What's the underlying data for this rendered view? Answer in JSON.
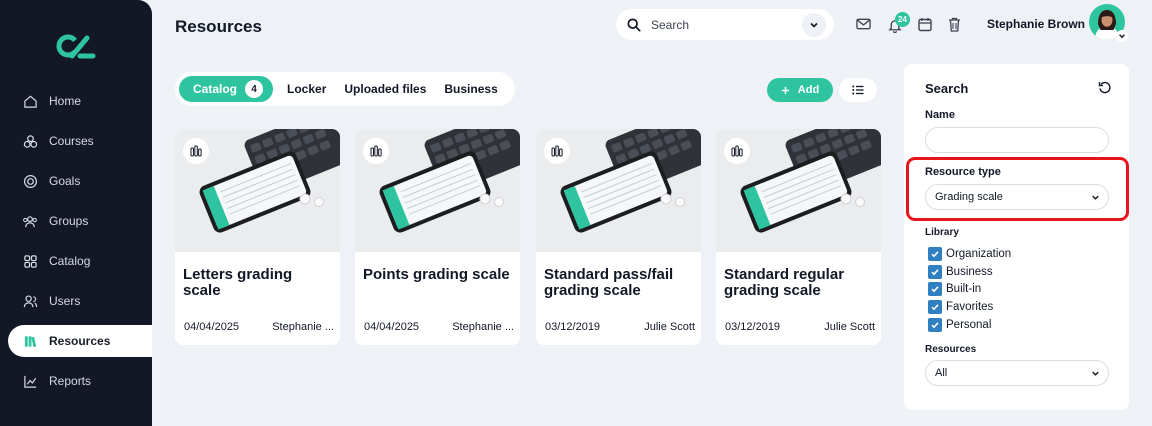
{
  "sidebar": {
    "items": [
      {
        "label": "Home",
        "icon": "home-icon",
        "active": false
      },
      {
        "label": "Courses",
        "icon": "courses-icon",
        "active": false
      },
      {
        "label": "Goals",
        "icon": "goals-icon",
        "active": false
      },
      {
        "label": "Groups",
        "icon": "groups-icon",
        "active": false
      },
      {
        "label": "Catalog",
        "icon": "catalog-icon",
        "active": false
      },
      {
        "label": "Users",
        "icon": "users-icon",
        "active": false
      },
      {
        "label": "Resources",
        "icon": "resources-icon",
        "active": true
      },
      {
        "label": "Reports",
        "icon": "reports-icon",
        "active": false
      }
    ]
  },
  "header": {
    "title": "Resources",
    "search_placeholder": "Search",
    "notification_count": "24",
    "user_name": "Stephanie Brown"
  },
  "tabs": [
    {
      "label": "Catalog",
      "count": "4",
      "active": true
    },
    {
      "label": "Locker"
    },
    {
      "label": "Uploaded files"
    },
    {
      "label": "Business"
    }
  ],
  "toolbar": {
    "add_label": "Add"
  },
  "cards": [
    {
      "title": "Letters grading scale",
      "date": "04/04/2025",
      "author": "Stephanie ..."
    },
    {
      "title": "Points grading scale",
      "date": "04/04/2025",
      "author": "Stephanie ..."
    },
    {
      "title": "Standard pass/fail grading scale",
      "date": "03/12/2019",
      "author": "Julie Scott"
    },
    {
      "title": "Standard regular grading scale",
      "date": "03/12/2019",
      "author": "Julie Scott"
    }
  ],
  "filters": {
    "title": "Search",
    "name_label": "Name",
    "name_value": "",
    "resource_type_label": "Resource type",
    "resource_type_value": "Grading scale",
    "library_label": "Library",
    "library_options": [
      {
        "label": "Organization",
        "checked": true
      },
      {
        "label": "Business",
        "checked": true
      },
      {
        "label": "Built-in",
        "checked": true
      },
      {
        "label": "Favorites",
        "checked": true
      },
      {
        "label": "Personal",
        "checked": true
      }
    ],
    "resources_label": "Resources",
    "resources_value": "All"
  },
  "colors": {
    "accent": "#2ec4a0",
    "sidebar": "#121826",
    "highlight": "#e8141c",
    "checkbox": "#2f7fc1"
  }
}
